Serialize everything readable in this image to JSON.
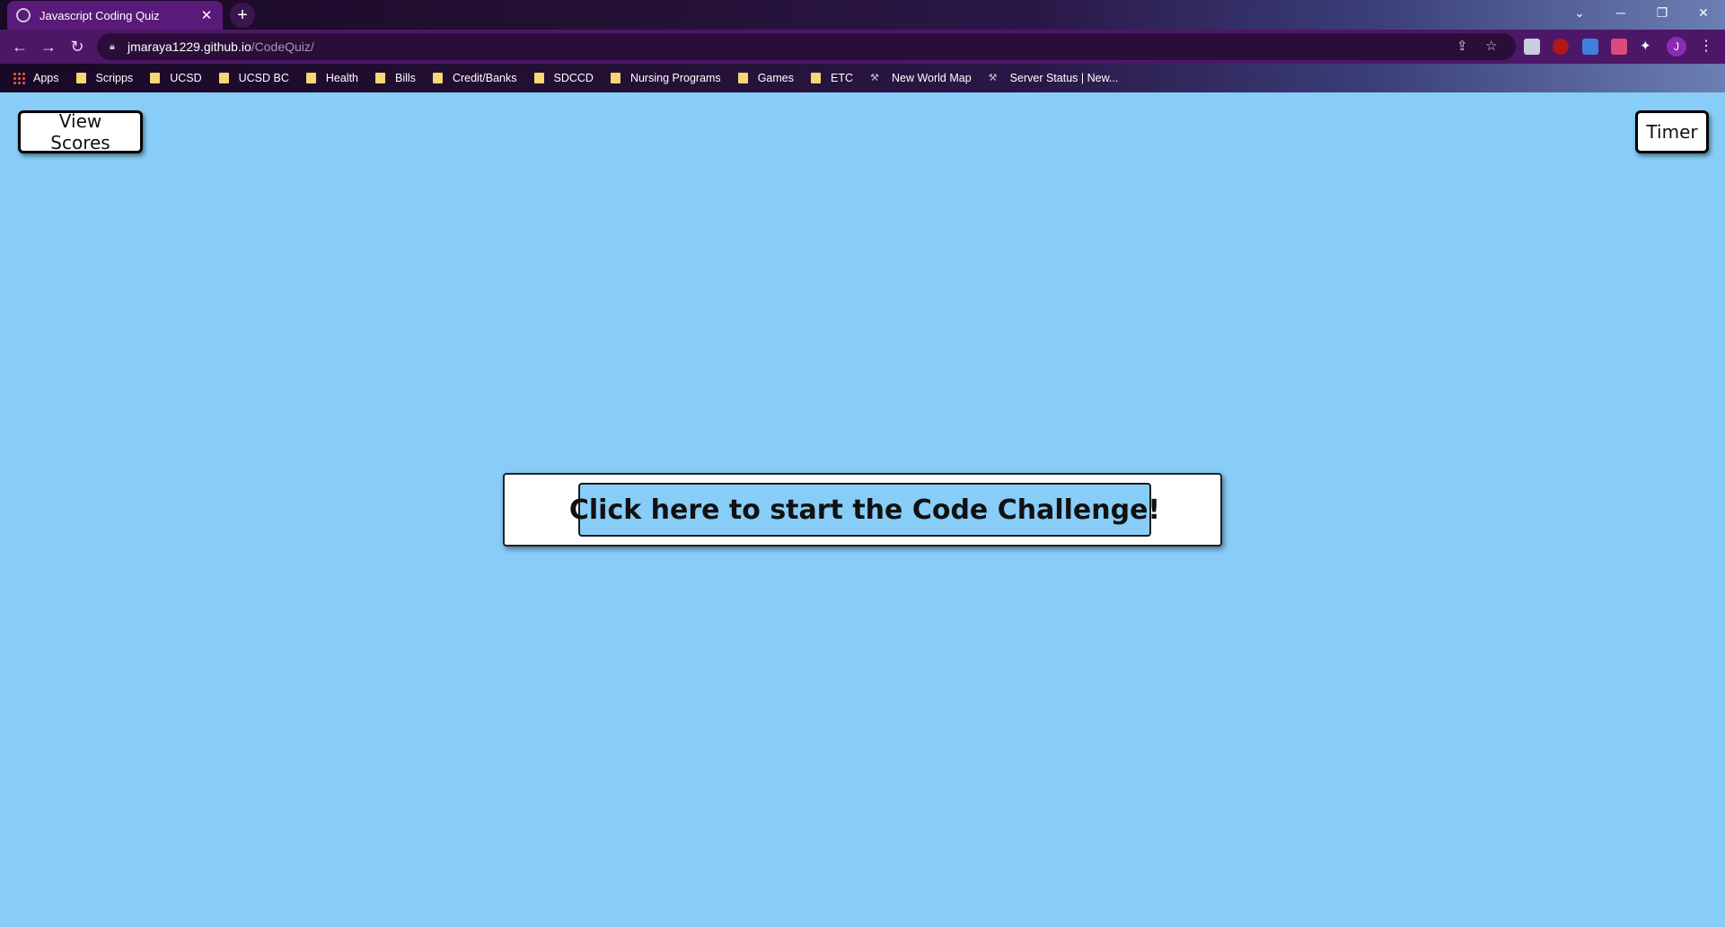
{
  "browser": {
    "tab_title": "Javascript Coding Quiz",
    "url_host": "jmaraya1229.github.io",
    "url_path": "/CodeQuiz/",
    "avatar_letter": "J",
    "bookmarks": [
      {
        "label": "Apps",
        "icon": "apps-icon"
      },
      {
        "label": "Scripps",
        "icon": "folder-icon"
      },
      {
        "label": "UCSD",
        "icon": "folder-icon"
      },
      {
        "label": "UCSD BC",
        "icon": "folder-icon"
      },
      {
        "label": "Health",
        "icon": "folder-icon"
      },
      {
        "label": "Bills",
        "icon": "folder-icon"
      },
      {
        "label": "Credit/Banks",
        "icon": "folder-icon"
      },
      {
        "label": "SDCCD",
        "icon": "folder-icon"
      },
      {
        "label": "Nursing Programs",
        "icon": "folder-icon"
      },
      {
        "label": "Games",
        "icon": "folder-icon"
      },
      {
        "label": "ETC",
        "icon": "folder-icon"
      },
      {
        "label": "New World Map",
        "icon": "globe-icon"
      },
      {
        "label": "Server Status | New...",
        "icon": "globe-icon"
      }
    ]
  },
  "page": {
    "view_scores_label": "View Scores",
    "timer_label": "Timer",
    "start_label": "Click here to start the Code Challenge!"
  },
  "colors": {
    "page_background": "#87cdf7",
    "start_button_background": "#87cdf7",
    "tab_active": "#5a1a7a"
  }
}
